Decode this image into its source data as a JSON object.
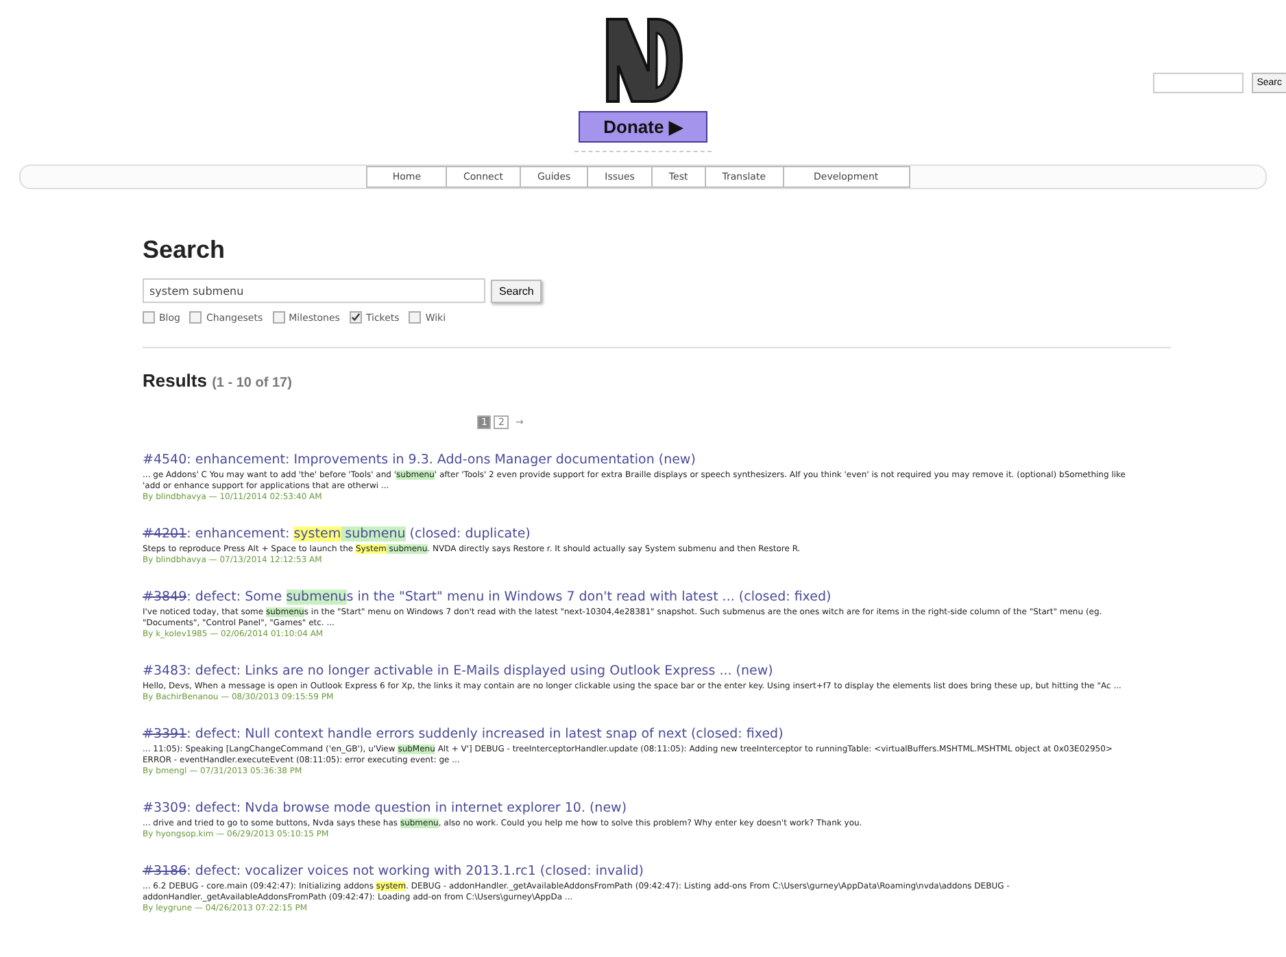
{
  "header": {
    "donate": "Donate ▶",
    "site_search": {
      "button": "Searc"
    }
  },
  "nav": [
    "Home",
    "Connect",
    "Guides",
    "Issues",
    "Test",
    "Translate",
    "Development"
  ],
  "search": {
    "heading": "Search",
    "query": "system submenu",
    "button": "Search",
    "filters": [
      {
        "label": "Blog",
        "checked": false
      },
      {
        "label": "Changesets",
        "checked": false
      },
      {
        "label": "Milestones",
        "checked": false
      },
      {
        "label": "Tickets",
        "checked": true
      },
      {
        "label": "Wiki",
        "checked": false
      }
    ]
  },
  "results_heading": {
    "title": "Results",
    "range": "(1 - 10 of 17)"
  },
  "pagination": {
    "pages": [
      {
        "label": "1",
        "selected": true
      },
      {
        "label": "2",
        "selected": false
      }
    ],
    "next": "→"
  },
  "results": [
    {
      "number": "#4540",
      "closed": false,
      "title": [
        {
          "text": ": enhancement: Improvements in 9.3. Add-ons Manager documentation (new)"
        }
      ],
      "excerpt": [
        {
          "text": "... ge Addons' C You may want to add 'the' before 'Tools' and '"
        },
        {
          "text": "submenu",
          "color": "#c8f0c0"
        },
        {
          "text": "' after 'Tools' 2 even provide support for extra Braille displays or speech synthesizers. AIf you think 'even' is not required you may remove it. (optional) bSomething like 'add or enhance support for applications that are otherwi ..."
        }
      ],
      "byline": "By blindbhavya — 10/11/2014 02:53:40 AM"
    },
    {
      "number": "#4201",
      "closed": true,
      "title": [
        {
          "text": ": enhancement: "
        },
        {
          "text": "system",
          "color": "#ffff7a"
        },
        {
          "text": " submenu",
          "color": "#c8f0c0"
        },
        {
          "text": " (closed: duplicate)"
        }
      ],
      "excerpt": [
        {
          "text": "Steps to reproduce Press Alt + Space to launch the "
        },
        {
          "text": "System",
          "color": "#ffff7a"
        },
        {
          "text": " submenu",
          "color": "#c8f0c0"
        },
        {
          "text": ". NVDA directly says Restore r. It should actually say System submenu and then Restore R."
        }
      ],
      "byline": "By blindbhavya — 07/13/2014 12:12:53 AM"
    },
    {
      "number": "#3849",
      "closed": true,
      "title": [
        {
          "text": ": defect: Some "
        },
        {
          "text": "submenu",
          "color": "#c8f0c0"
        },
        {
          "text": "s in the \"Start\" menu in Windows 7 don't read with latest ... (closed: fixed)"
        }
      ],
      "excerpt": [
        {
          "text": "I've noticed today, that some "
        },
        {
          "text": "submenu",
          "color": "#c8f0c0"
        },
        {
          "text": "s in the \"Start\" menu on Windows 7 don't read with the latest \"next-10304,4e28381\" snapshot. Such submenus are the ones witch are for items in the right-side column of the \"Start\" menu (eg. \"Documents\", \"Control Panel\", \"Games\" etc. ..."
        }
      ],
      "byline": "By k_kolev1985 — 02/06/2014 01:10:04 AM"
    },
    {
      "number": "#3483",
      "closed": false,
      "title": [
        {
          "text": ": defect: Links are no longer activable in E-Mails displayed using Outlook Express ... (new)"
        }
      ],
      "excerpt": [
        {
          "text": "Hello, Devs, When a message is open in Outlook Express 6 for Xp, the links it may contain are no longer clickable using the space bar or the enter key. Using insert+f7 to display the elements list does bring these up, but hitting the \"Ac ..."
        }
      ],
      "byline": "By BachirBenanou — 08/30/2013 09:15:59 PM"
    },
    {
      "number": "#3391",
      "closed": true,
      "title": [
        {
          "text": ": defect: Null context handle errors suddenly increased in latest snap of next (closed: fixed)"
        }
      ],
      "excerpt": [
        {
          "text": "... 11:05): Speaking [LangChangeCommand ('en_GB'), u'View "
        },
        {
          "text": "subMenu",
          "color": "#c8f0c0"
        },
        {
          "text": " Alt + V'] DEBUG - treeInterceptorHandler.update (08:11:05): Adding new treeInterceptor to runningTable: <virtualBuffers.MSHTML.MSHTML object at 0x03E02950> ERROR - eventHandler.executeEvent (08:11:05): error executing event: ge ..."
        }
      ],
      "byline": "By bmengl — 07/31/2013 05:36:38 PM"
    },
    {
      "number": "#3309",
      "closed": false,
      "title": [
        {
          "text": ": defect: Nvda browse mode question in internet explorer 10. (new)"
        }
      ],
      "excerpt": [
        {
          "text": "... drive and tried to go to some buttons, Nvda says these has "
        },
        {
          "text": "submenu",
          "color": "#c8f0c0"
        },
        {
          "text": ", also no work. Could you help me how to solve this problem? Why enter key doesn't work? Thank you."
        }
      ],
      "byline": "By hyongsop.kim — 06/29/2013 05:10:15 PM"
    },
    {
      "number": "#3186",
      "closed": true,
      "title": [
        {
          "text": ": defect: vocalizer voices not working with 2013.1.rc1 (closed: invalid)"
        }
      ],
      "excerpt": [
        {
          "text": "... 6.2 DEBUG - core.main (09:42:47): Initializing addons "
        },
        {
          "text": "system",
          "color": "#ffff7a"
        },
        {
          "text": ". DEBUG - addonHandler._getAvailableAddonsFromPath (09:42:47): Listing add-ons From C:\\Users\\gurney\\AppData\\Roaming\\nvda\\addons DEBUG - addonHandler._getAvailableAddonsFromPath (09:42:47): Loading add-on from C:\\Users\\gurney\\AppDa ..."
        }
      ],
      "byline": "By leygrune — 04/26/2013 07:22:15 PM"
    }
  ]
}
